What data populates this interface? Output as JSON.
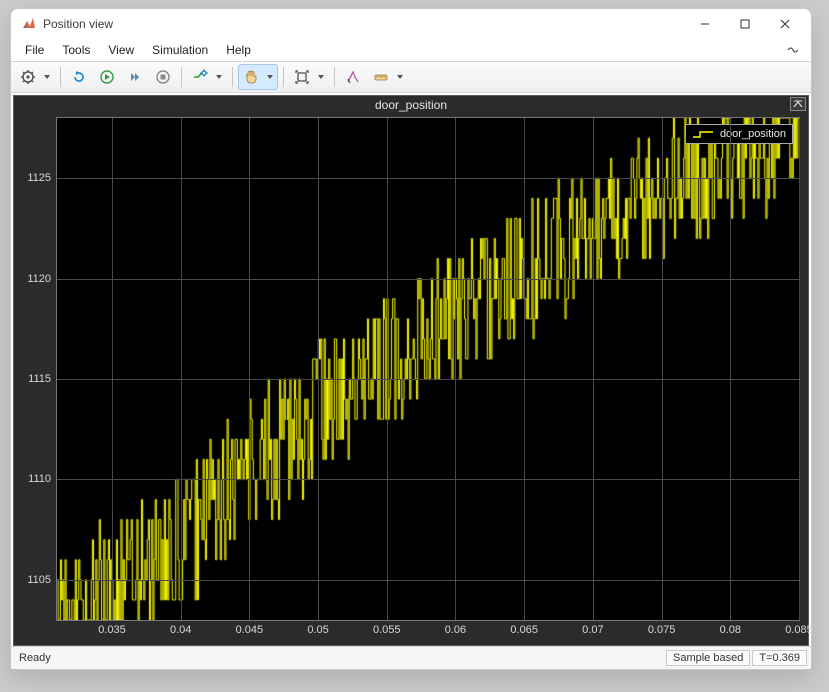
{
  "window": {
    "title": "Position view"
  },
  "menu": {
    "items": [
      "File",
      "Tools",
      "View",
      "Simulation",
      "Help"
    ]
  },
  "plot": {
    "title": "door_position",
    "legend_label": "door_position"
  },
  "status": {
    "ready": "Ready",
    "mode": "Sample based",
    "time": "T=0.369"
  },
  "chart_data": {
    "type": "line",
    "title": "door_position",
    "xlabel": "",
    "ylabel": "",
    "xlim": [
      0.031,
      0.085
    ],
    "ylim": [
      1103,
      1128
    ],
    "x_ticks": [
      0.035,
      0.04,
      0.045,
      0.05,
      0.055,
      0.06,
      0.065,
      0.07,
      0.075,
      0.08,
      0.085
    ],
    "y_ticks": [
      1105,
      1110,
      1115,
      1120,
      1125
    ],
    "series": [
      {
        "name": "door_position",
        "color": "#ffff00",
        "description": "noisy step-like integer-valued encoder signal rising roughly linearly from ~1103 at x≈0.031 to ~1127 at x≈0.085 with ±1..4 count jitter",
        "trend": [
          {
            "x": 0.031,
            "y": 1103.2
          },
          {
            "x": 0.035,
            "y": 1104.8
          },
          {
            "x": 0.04,
            "y": 1106.7
          },
          {
            "x": 0.045,
            "y": 1110.4
          },
          {
            "x": 0.05,
            "y": 1113.5
          },
          {
            "x": 0.055,
            "y": 1115.8
          },
          {
            "x": 0.06,
            "y": 1118.2
          },
          {
            "x": 0.065,
            "y": 1120.3
          },
          {
            "x": 0.07,
            "y": 1122.6
          },
          {
            "x": 0.075,
            "y": 1124.7
          },
          {
            "x": 0.08,
            "y": 1126.2
          },
          {
            "x": 0.085,
            "y": 1127.1
          }
        ],
        "noise_amplitude_counts": 3.5
      }
    ]
  }
}
